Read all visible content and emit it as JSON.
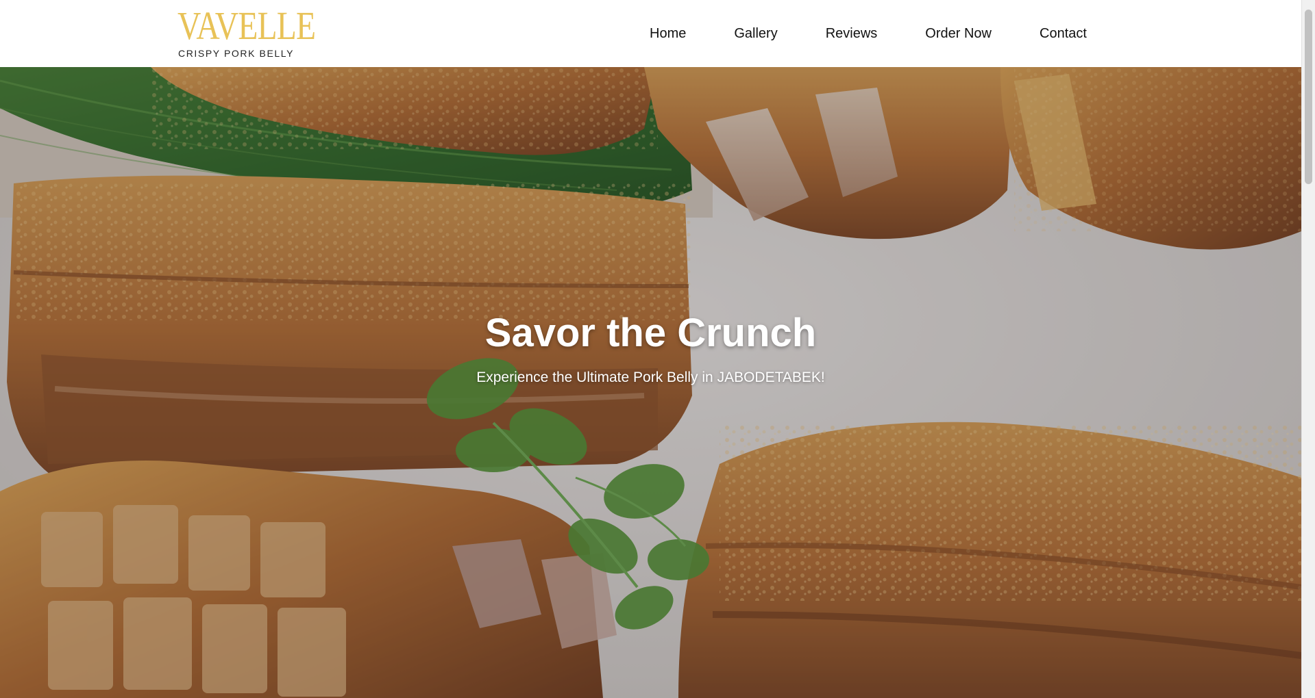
{
  "brand": {
    "name": "VAVELLE",
    "tagline": "CRISPY PORK BELLY",
    "logo_color": "#e8c257"
  },
  "nav": {
    "items": [
      {
        "label": "Home"
      },
      {
        "label": "Gallery"
      },
      {
        "label": "Reviews"
      },
      {
        "label": "Order Now"
      },
      {
        "label": "Contact"
      }
    ]
  },
  "hero": {
    "title": "Savor the Crunch",
    "subtitle": "Experience the Ultimate Pork Belly in JABODETABEK!"
  },
  "colors": {
    "header_bg": "#ffffff",
    "nav_text": "#111111",
    "hero_text": "#ffffff"
  }
}
